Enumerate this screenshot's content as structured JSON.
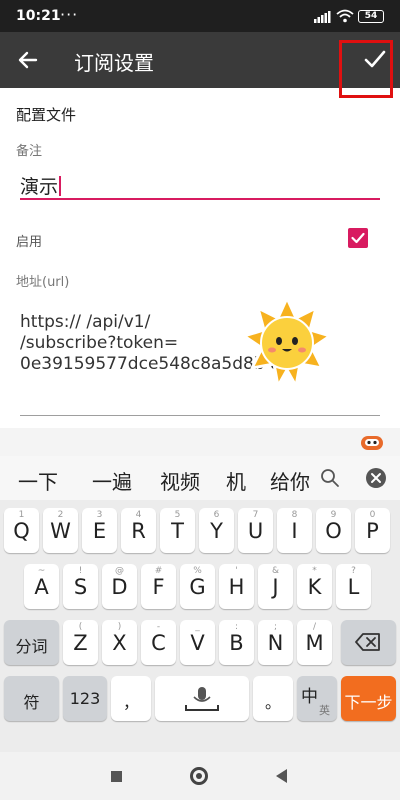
{
  "status_bar": {
    "time": "10:21",
    "dots": "···",
    "battery": "54"
  },
  "app_bar": {
    "title": "订阅设置",
    "back_icon": "arrow-left-icon",
    "confirm_icon": "check-icon"
  },
  "form": {
    "section_title": "配置文件",
    "remark_label": "备注",
    "remark_value": "演示",
    "enable_label": "启用",
    "enable_checked": true,
    "url_label": "地址(url)",
    "url_value": "https://                    /api/v1/\n/subscribe?token=\n0e39159577dce548c8a5d8b        80"
  },
  "keyboard": {
    "candidates": [
      "一下",
      "一遍",
      "视频",
      "机",
      "给你"
    ],
    "row1": [
      {
        "main": "Q",
        "hint": "1"
      },
      {
        "main": "W",
        "hint": "2"
      },
      {
        "main": "E",
        "hint": "3"
      },
      {
        "main": "R",
        "hint": "4"
      },
      {
        "main": "T",
        "hint": "5"
      },
      {
        "main": "Y",
        "hint": "6"
      },
      {
        "main": "U",
        "hint": "7"
      },
      {
        "main": "I",
        "hint": "8"
      },
      {
        "main": "O",
        "hint": "9"
      },
      {
        "main": "P",
        "hint": "0"
      }
    ],
    "row2": [
      {
        "main": "A",
        "hint": "~"
      },
      {
        "main": "S",
        "hint": "!"
      },
      {
        "main": "D",
        "hint": "@"
      },
      {
        "main": "F",
        "hint": "#"
      },
      {
        "main": "G",
        "hint": "%"
      },
      {
        "main": "H",
        "hint": "'"
      },
      {
        "main": "J",
        "hint": "&"
      },
      {
        "main": "K",
        "hint": "*"
      },
      {
        "main": "L",
        "hint": "?"
      }
    ],
    "row3": [
      {
        "main": "Z",
        "hint": "("
      },
      {
        "main": "X",
        "hint": ")"
      },
      {
        "main": "C",
        "hint": "-"
      },
      {
        "main": "V",
        "hint": "_"
      },
      {
        "main": "B",
        "hint": ":"
      },
      {
        "main": "N",
        "hint": ";"
      },
      {
        "main": "M",
        "hint": "/"
      }
    ],
    "segment_key": "分词",
    "symbol_key": "符",
    "num_key": "123",
    "comma_key": "，",
    "period_key": "。",
    "lang_key_main": "中",
    "lang_key_sub": "英",
    "next_key": "下一步",
    "accent_color": "#d81b60",
    "next_color": "#f26d1f"
  }
}
